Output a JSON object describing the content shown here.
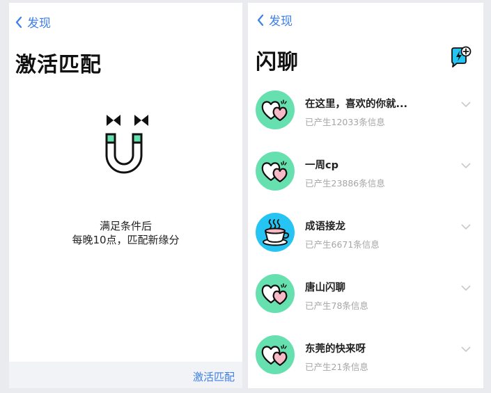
{
  "left": {
    "back_label": "发现",
    "title": "激活匹配",
    "hint_line1": "满足条件后",
    "hint_line2": "每晚10点，匹配新缘分",
    "activate_button": "激活匹配"
  },
  "right": {
    "back_label": "发现",
    "title": "闪聊",
    "items": [
      {
        "title": "在这里，喜欢的你就...",
        "subtitle": "已产生12033条信息",
        "avatar": "hearts-icon",
        "avatar_color": "#67e0b0"
      },
      {
        "title": "一周cp",
        "subtitle": "已产生23886条信息",
        "avatar": "hearts-icon",
        "avatar_color": "#67e0b0"
      },
      {
        "title": "成语接龙",
        "subtitle": "已产生6671条信息",
        "avatar": "tea-cup-icon",
        "avatar_color": "#25c4f2"
      },
      {
        "title": "唐山闪聊",
        "subtitle": "已产生78条信息",
        "avatar": "hearts-icon",
        "avatar_color": "#67e0b0"
      },
      {
        "title": "东莞的快来呀",
        "subtitle": "已产生21条信息",
        "avatar": "hearts-icon",
        "avatar_color": "#67e0b0"
      }
    ]
  },
  "colors": {
    "accent": "#3d7fe8",
    "mint": "#67e0b0",
    "cyan": "#25c4f2",
    "pink": "#f7b9c6"
  }
}
